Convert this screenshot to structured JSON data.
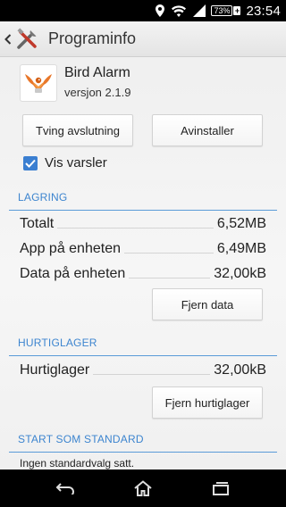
{
  "status_bar": {
    "battery": "73%",
    "battery_charging": "+",
    "time": "23:54",
    "icons": [
      "location-icon",
      "wifi-icon",
      "signal-icon"
    ]
  },
  "action_bar": {
    "title": "Programinfo",
    "back_icon": "chevron-left-icon",
    "app_icon": "tools-icon"
  },
  "app": {
    "name": "Bird Alarm",
    "version": "versjon 2.1.9"
  },
  "buttons": {
    "force_stop": "Tving avslutning",
    "uninstall": "Avinstaller",
    "clear_data": "Fjern data",
    "clear_cache": "Fjern hurtiglager"
  },
  "notifications": {
    "label": "Vis varsler",
    "checked": true
  },
  "storage": {
    "header": "LAGRING",
    "rows": [
      {
        "label": "Totalt",
        "value": "6,52MB"
      },
      {
        "label": "App på enheten",
        "value": "6,49MB"
      },
      {
        "label": "Data på enheten",
        "value": "32,00kB"
      }
    ]
  },
  "cache": {
    "header": "HURTIGLAGER",
    "rows": [
      {
        "label": "Hurtiglager",
        "value": "32,00kB"
      }
    ]
  },
  "launch_default": {
    "header": "START SOM STANDARD",
    "text": "Ingen standardvalg satt."
  },
  "nav_bar": {
    "icons": [
      "back-icon",
      "home-icon",
      "recents-icon"
    ]
  },
  "colors": {
    "accent": "#3d85cf",
    "checkbox": "#3b7fd1"
  }
}
